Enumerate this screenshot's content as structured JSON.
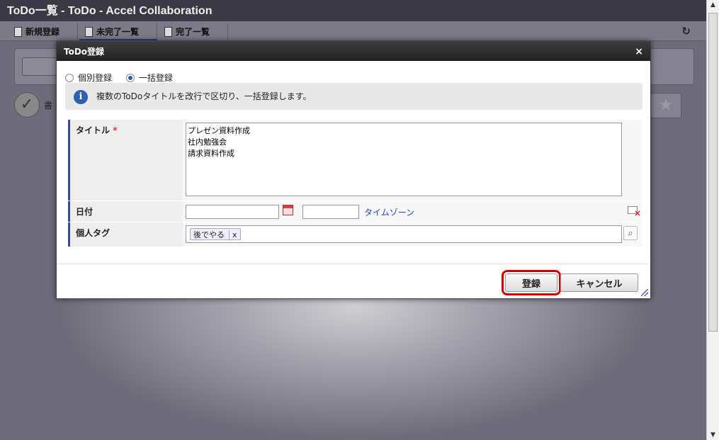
{
  "window": {
    "title": "ToDo一覧 - ToDo - Accel Collaboration"
  },
  "toolbar": {
    "items": [
      {
        "label": "新規登録"
      },
      {
        "label": "未完了一覧"
      },
      {
        "label": "完了一覧"
      }
    ],
    "refresh_icon": "refresh-icon"
  },
  "background": {
    "item_text": "書"
  },
  "dialog": {
    "title": "ToDo登録",
    "close_glyph": "×",
    "mode": {
      "individual_label": "個別登録",
      "bulk_label": "一括登録",
      "selected": "bulk"
    },
    "info_text": "複数のToDoタイトルを改行で区切り、一括登録します。",
    "form": {
      "title_label": "タイトル",
      "required_mark": "*",
      "title_value": "プレゼン資料作成\n社内勉強会\n請求資料作成",
      "date_label": "日付",
      "date_value": "",
      "time_value": "",
      "timezone_link": "タイムゾーン",
      "tag_label": "個人タグ",
      "tags": [
        {
          "label": "後でやる",
          "remove": "x"
        }
      ]
    },
    "buttons": {
      "register": "登録",
      "cancel": "キャンセル"
    }
  },
  "colors": {
    "accent": "#3a4b8a",
    "highlight": "#d40000",
    "link": "#1e4ea8"
  }
}
